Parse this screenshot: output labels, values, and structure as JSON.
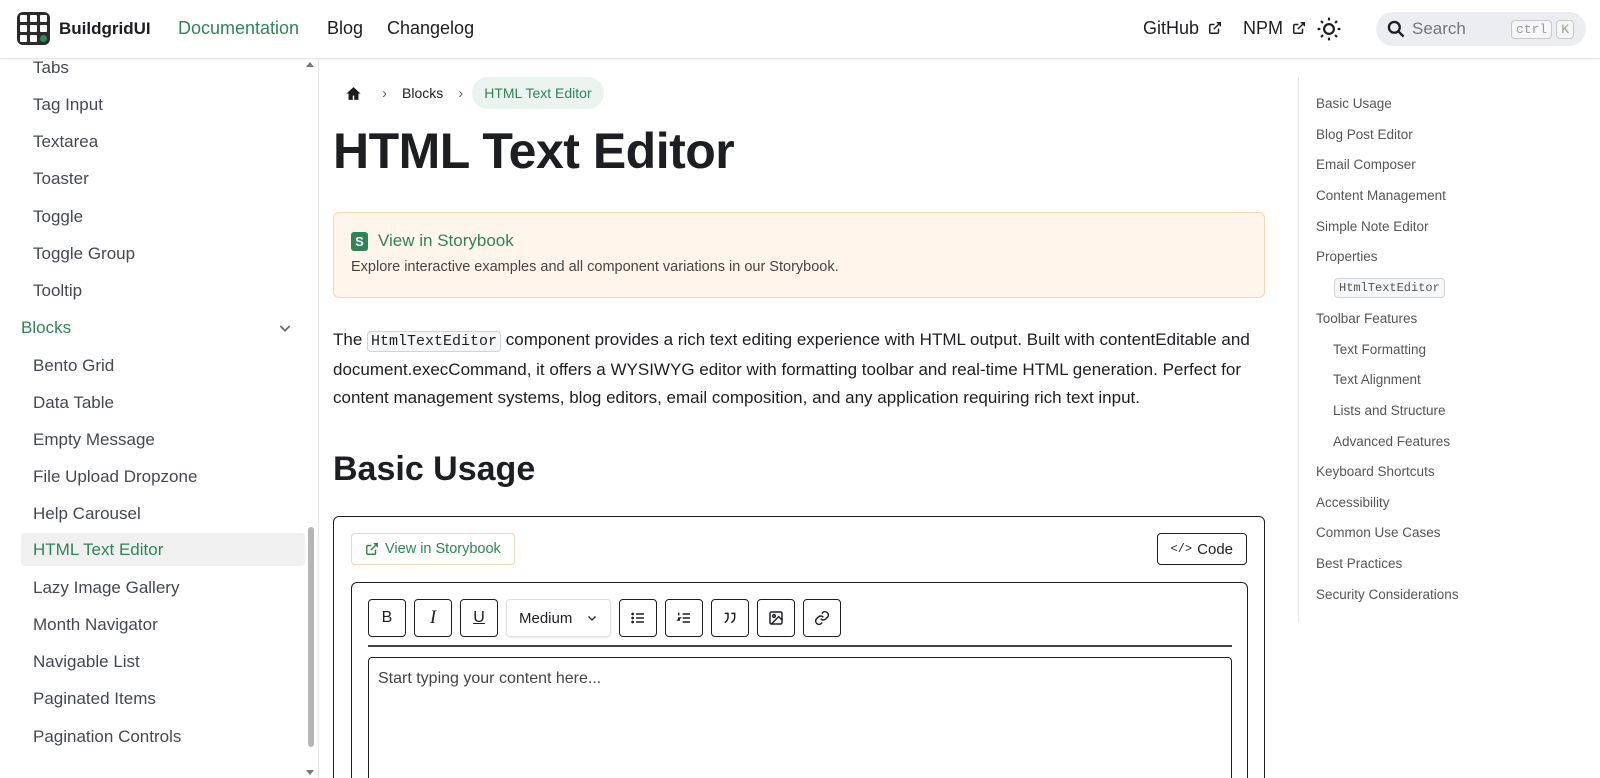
{
  "navbar": {
    "brand": "BuildgridUI",
    "links": [
      {
        "label": "Documentation",
        "active": true
      },
      {
        "label": "Blog"
      },
      {
        "label": "Changelog"
      }
    ],
    "right_links": [
      "GitHub",
      "NPM"
    ],
    "search": {
      "placeholder": "Search",
      "kbd1": "ctrl",
      "kbd2": "K"
    }
  },
  "sidebar": {
    "items_top": [
      "Tabs",
      "Tag Input",
      "Textarea",
      "Toaster",
      "Toggle",
      "Toggle Group",
      "Tooltip"
    ],
    "category": "Blocks",
    "items_blocks": [
      "Bento Grid",
      "Data Table",
      "Empty Message",
      "File Upload Dropzone",
      "Help Carousel",
      "HTML Text Editor",
      "Lazy Image Gallery",
      "Month Navigator",
      "Navigable List",
      "Paginated Items",
      "Pagination Controls"
    ],
    "active": "HTML Text Editor"
  },
  "breadcrumb": {
    "section": "Blocks",
    "current": "HTML Text Editor"
  },
  "page": {
    "title": "HTML Text Editor",
    "admonition": {
      "link": "View in Storybook",
      "text": "Explore interactive examples and all component variations in our Storybook."
    },
    "intro_before": "The ",
    "intro_code": "HtmlTextEditor",
    "intro_after": " component provides a rich text editing experience with HTML output. Built with contentEditable and document.execCommand, it offers a WYSIWYG editor with formatting toolbar and real-time HTML generation. Perfect for content management systems, blog editors, email composition, and any application requiring rich text input.",
    "section_heading": "Basic Usage",
    "demo": {
      "storybook_link": "View in Storybook",
      "code_button": "Code",
      "toolbar": {
        "bold": "B",
        "italic": "I",
        "underline": "U",
        "size": "Medium"
      },
      "placeholder": "Start typing your content here..."
    }
  },
  "toc": {
    "items": [
      {
        "label": "Basic Usage",
        "level": 1
      },
      {
        "label": "Blog Post Editor",
        "level": 1
      },
      {
        "label": "Email Composer",
        "level": 1
      },
      {
        "label": "Content Management",
        "level": 1
      },
      {
        "label": "Simple Note Editor",
        "level": 1
      },
      {
        "label": "Properties",
        "level": 1
      },
      {
        "label": "HtmlTextEditor",
        "level": 2,
        "code": true
      },
      {
        "label": "Toolbar Features",
        "level": 1
      },
      {
        "label": "Text Formatting",
        "level": 2
      },
      {
        "label": "Text Alignment",
        "level": 2
      },
      {
        "label": "Lists and Structure",
        "level": 2
      },
      {
        "label": "Advanced Features",
        "level": 2
      },
      {
        "label": "Keyboard Shortcuts",
        "level": 1
      },
      {
        "label": "Accessibility",
        "level": 1
      },
      {
        "label": "Common Use Cases",
        "level": 1
      },
      {
        "label": "Best Practices",
        "level": 1
      },
      {
        "label": "Security Considerations",
        "level": 1
      }
    ]
  },
  "colors": {
    "accent": "#2e8555",
    "admonition_bg": "#fff5eb"
  }
}
